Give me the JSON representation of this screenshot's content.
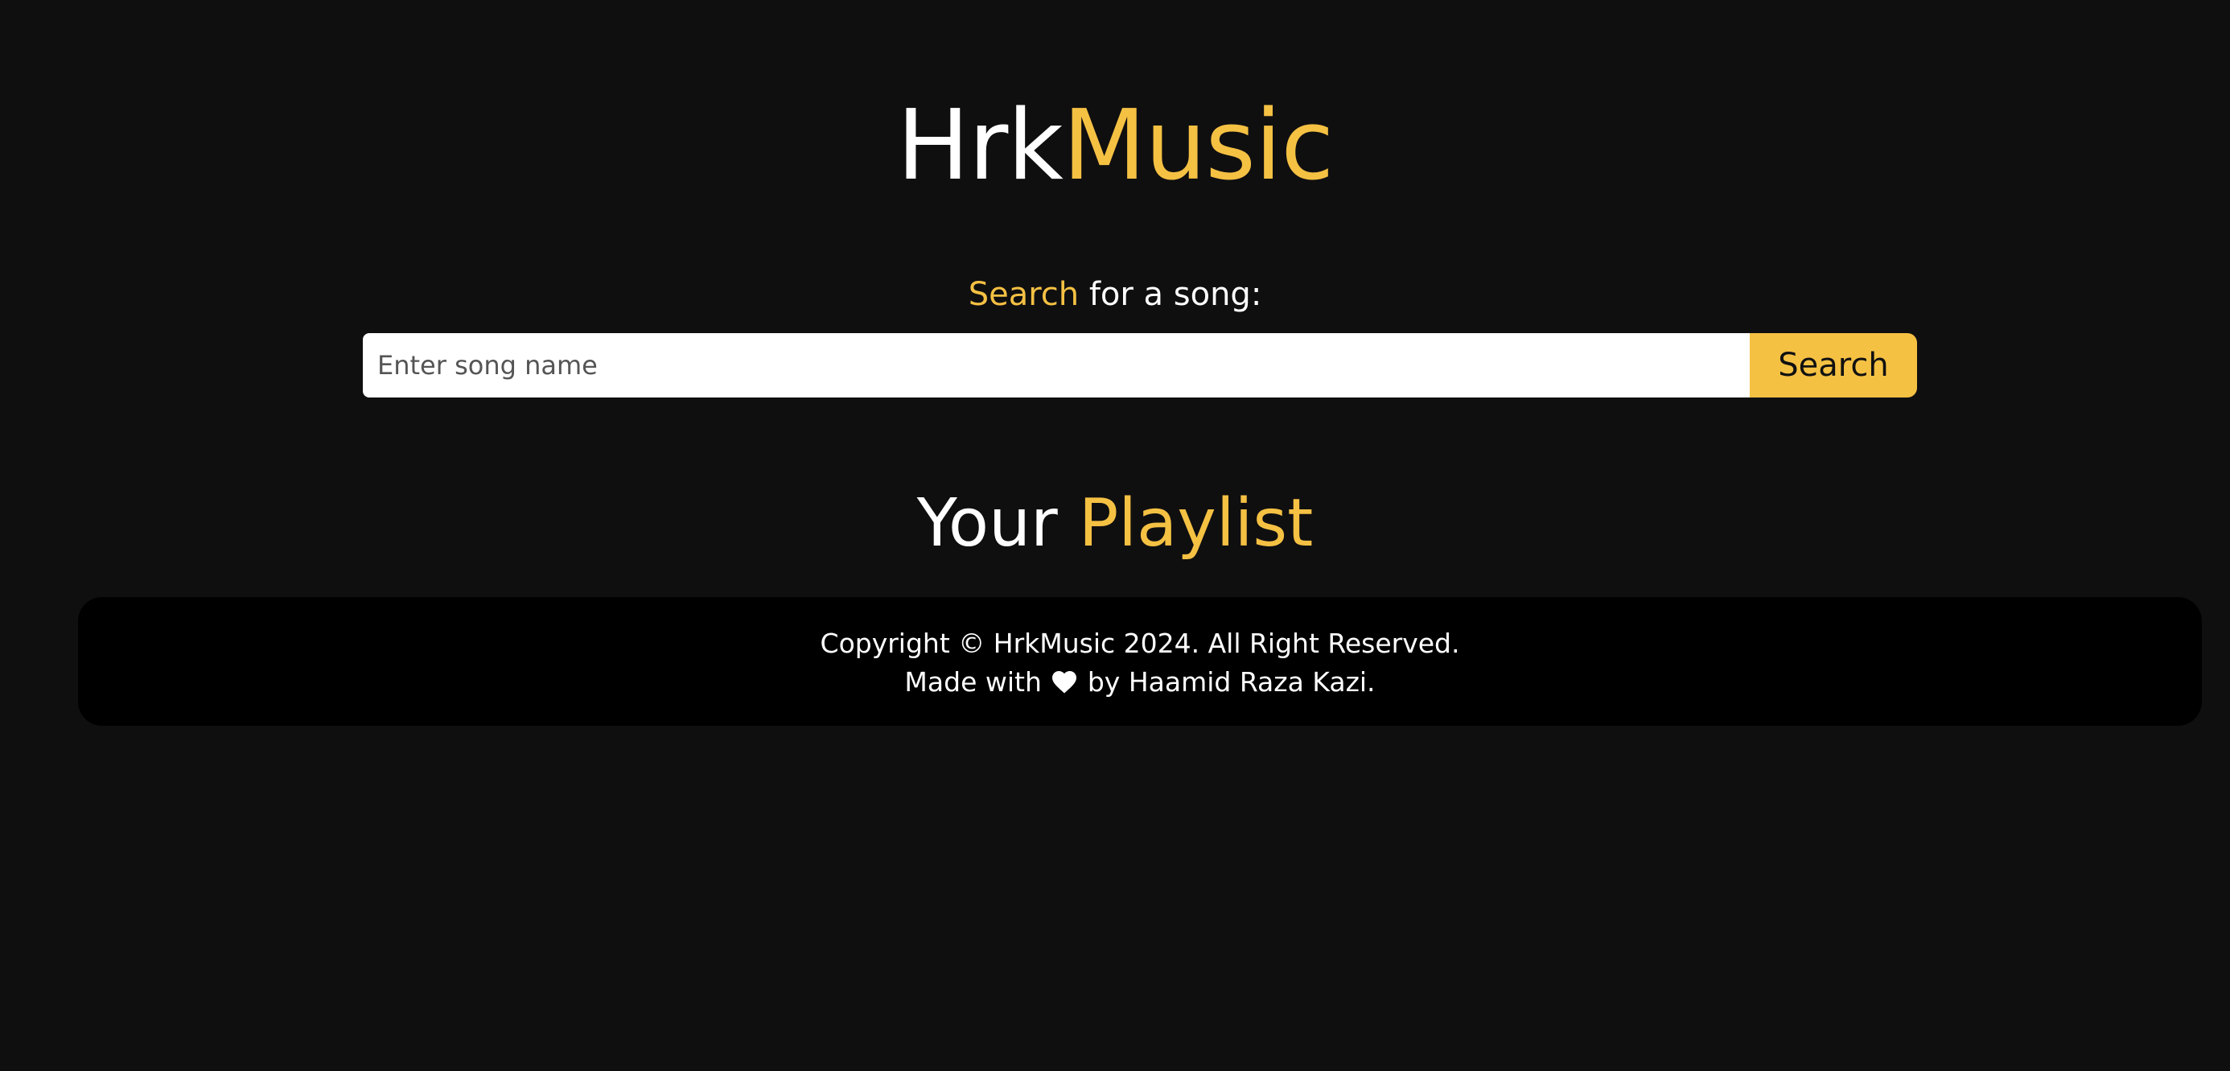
{
  "brand": {
    "part1": "Hrk",
    "part2": "Music",
    "accent_color": "#f5c143"
  },
  "search": {
    "label_accent": "Search",
    "label_rest": " for a song:",
    "placeholder": "Enter song name",
    "value": "",
    "button_label": "Search"
  },
  "playlist": {
    "title_part1": "Your ",
    "title_part2": "Playlist"
  },
  "footer": {
    "copyright": "Copyright © HrkMusic 2024. All Right Reserved.",
    "made_with_prefix": "Made with ",
    "heart_icon": "heart-icon",
    "made_with_suffix": " by Haamid Raza Kazi."
  },
  "colors": {
    "background": "#100f10",
    "footer_background": "#000000",
    "accent": "#f5c143",
    "text": "#ffffff"
  }
}
